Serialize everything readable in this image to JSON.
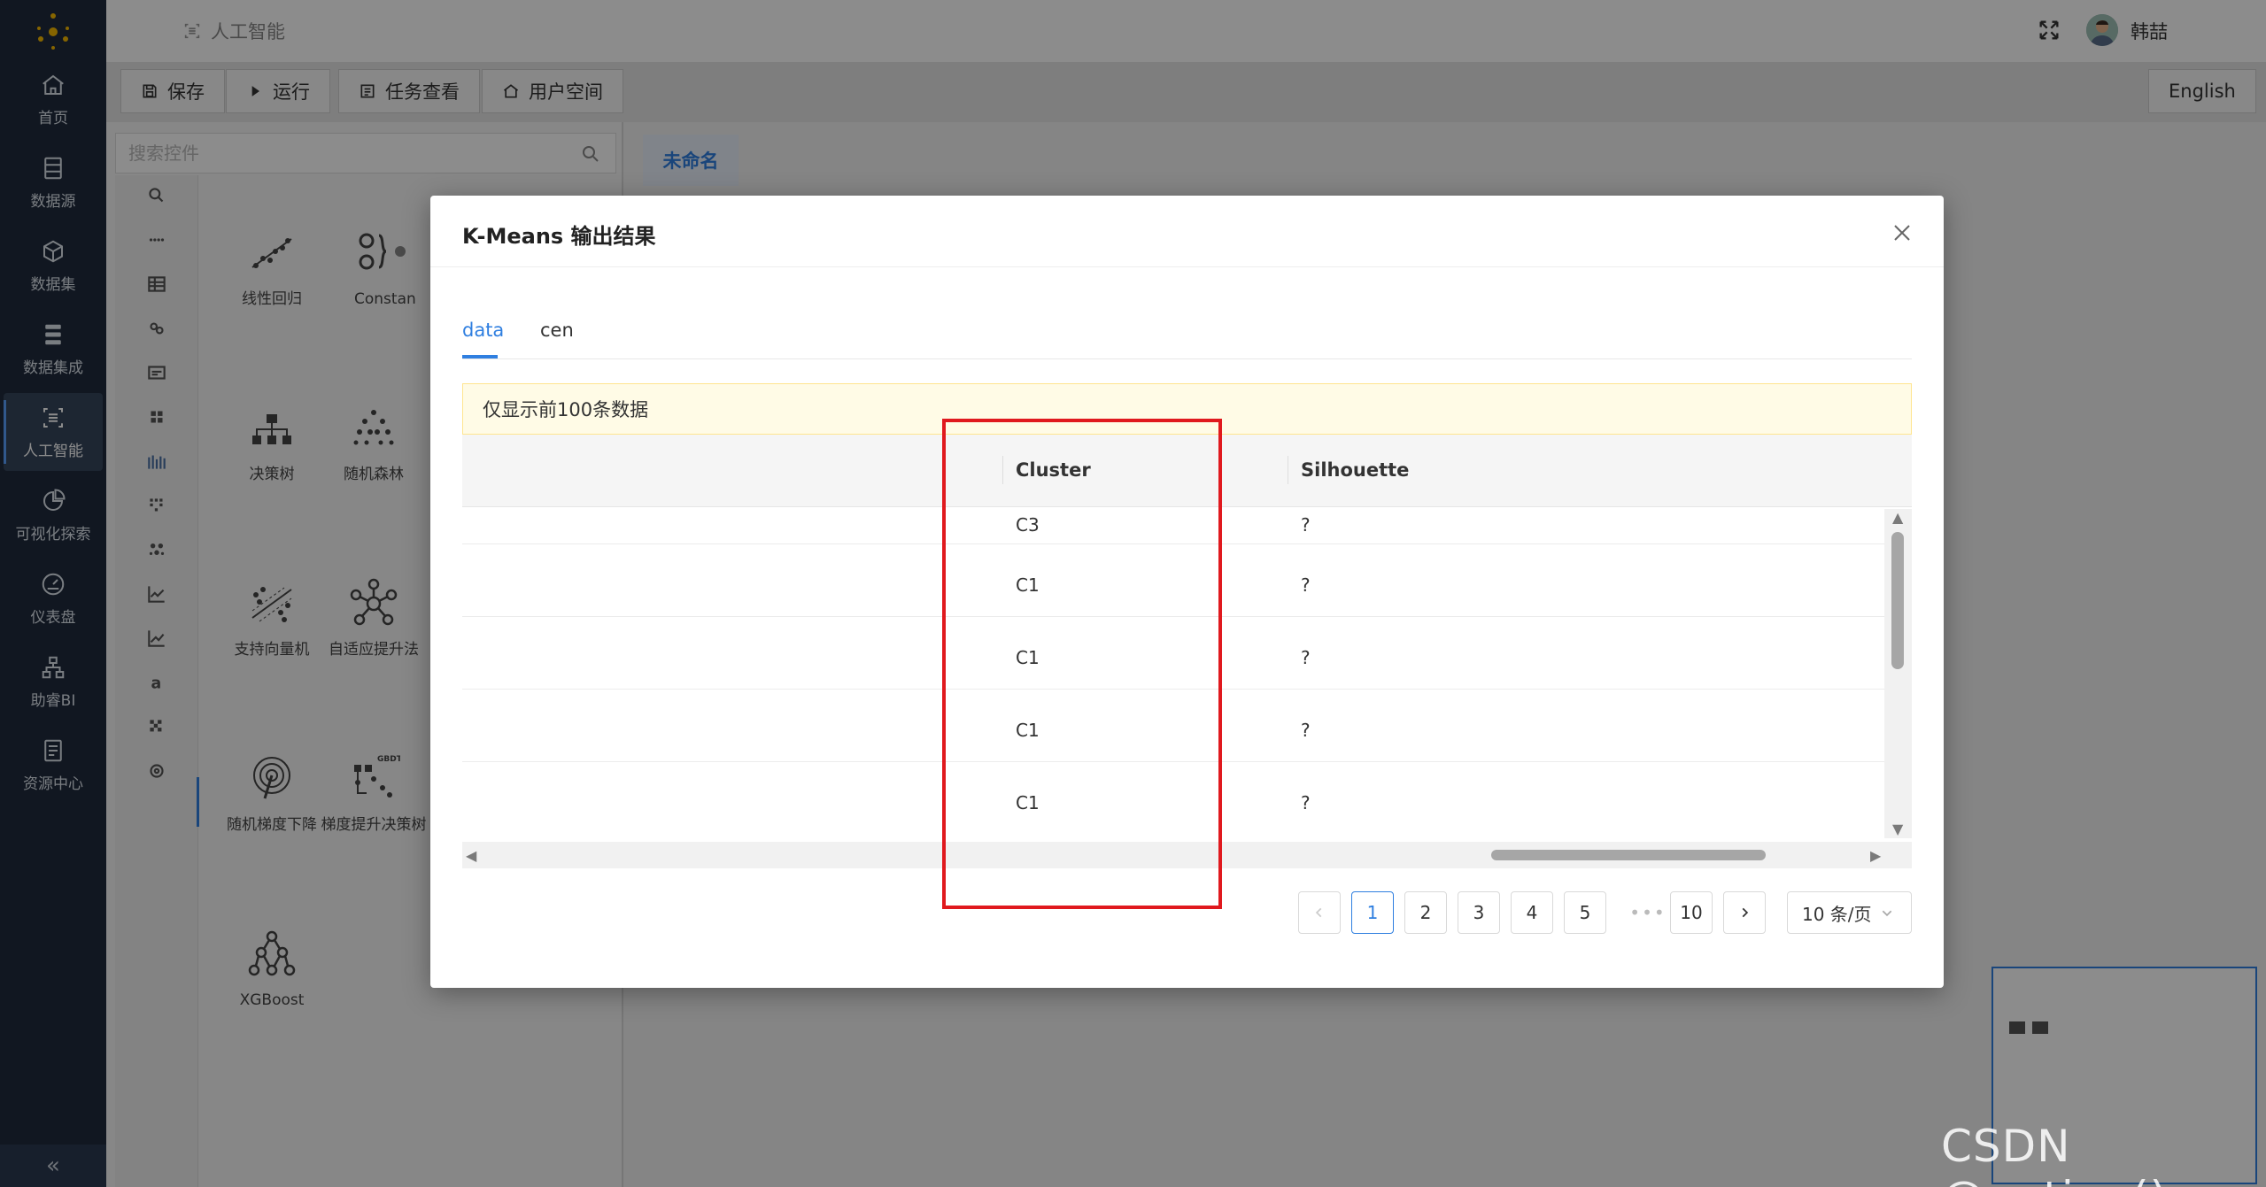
{
  "sidebar": {
    "items": [
      {
        "label": "首页",
        "icon": "home-icon"
      },
      {
        "label": "数据源",
        "icon": "database-icon"
      },
      {
        "label": "数据集",
        "icon": "cube-icon"
      },
      {
        "label": "数据集成",
        "icon": "server-stack-icon"
      },
      {
        "label": "人工智能",
        "icon": "ai-scan-icon",
        "active": true
      },
      {
        "label": "可视化探索",
        "icon": "pie-chart-icon"
      },
      {
        "label": "仪表盘",
        "icon": "gauge-icon"
      },
      {
        "label": "助睿BI",
        "icon": "org-chart-icon"
      },
      {
        "label": "资源中心",
        "icon": "document-icon"
      }
    ],
    "collapse_label": "«"
  },
  "header": {
    "breadcrumb": "人工智能",
    "username": "韩喆"
  },
  "toolbar": {
    "save": "保存",
    "run": "运行",
    "tasks": "任务查看",
    "user_space": "用户空间",
    "language": "English"
  },
  "components": {
    "search_placeholder": "搜索控件",
    "items": [
      {
        "label": "线性回归",
        "icon": "linear-regression-icon"
      },
      {
        "label": "Constan",
        "icon": "constant-icon"
      },
      {
        "label": "决策树",
        "icon": "decision-tree-icon"
      },
      {
        "label": "随机森林",
        "icon": "random-forest-icon"
      },
      {
        "label": "支持向量机",
        "icon": "svm-icon"
      },
      {
        "label": "自适应提升法",
        "icon": "adaboost-icon"
      },
      {
        "label": "随机梯度下降",
        "icon": "sgd-icon"
      },
      {
        "label": "梯度提升决策树",
        "icon": "gbdt-icon"
      },
      {
        "label": "XGBoost",
        "icon": "xgboost-icon"
      }
    ]
  },
  "canvas": {
    "tab_label": "未命名"
  },
  "modal": {
    "title": "K-Means 输出结果",
    "tabs": [
      {
        "label": "data",
        "active": true
      },
      {
        "label": "cen",
        "active": false
      }
    ],
    "notice": "仅显示前100条数据",
    "columns": [
      "Cluster",
      "Silhouette"
    ],
    "rows": [
      {
        "cluster": "C3",
        "silhouette": "?"
      },
      {
        "cluster": "C1",
        "silhouette": "?"
      },
      {
        "cluster": "C1",
        "silhouette": "?"
      },
      {
        "cluster": "C1",
        "silhouette": "?"
      },
      {
        "cluster": "C1",
        "silhouette": "?"
      }
    ],
    "pagination": {
      "pages": [
        "1",
        "2",
        "3",
        "4",
        "5"
      ],
      "ellipsis": "•••",
      "last": "10",
      "current": "1",
      "page_size": "10 条/页"
    }
  },
  "watermark": "CSDN @potion()",
  "colors": {
    "accent": "#2f7fe0",
    "sidebar": "#1f2b3d",
    "highlight": "#e0191e"
  }
}
